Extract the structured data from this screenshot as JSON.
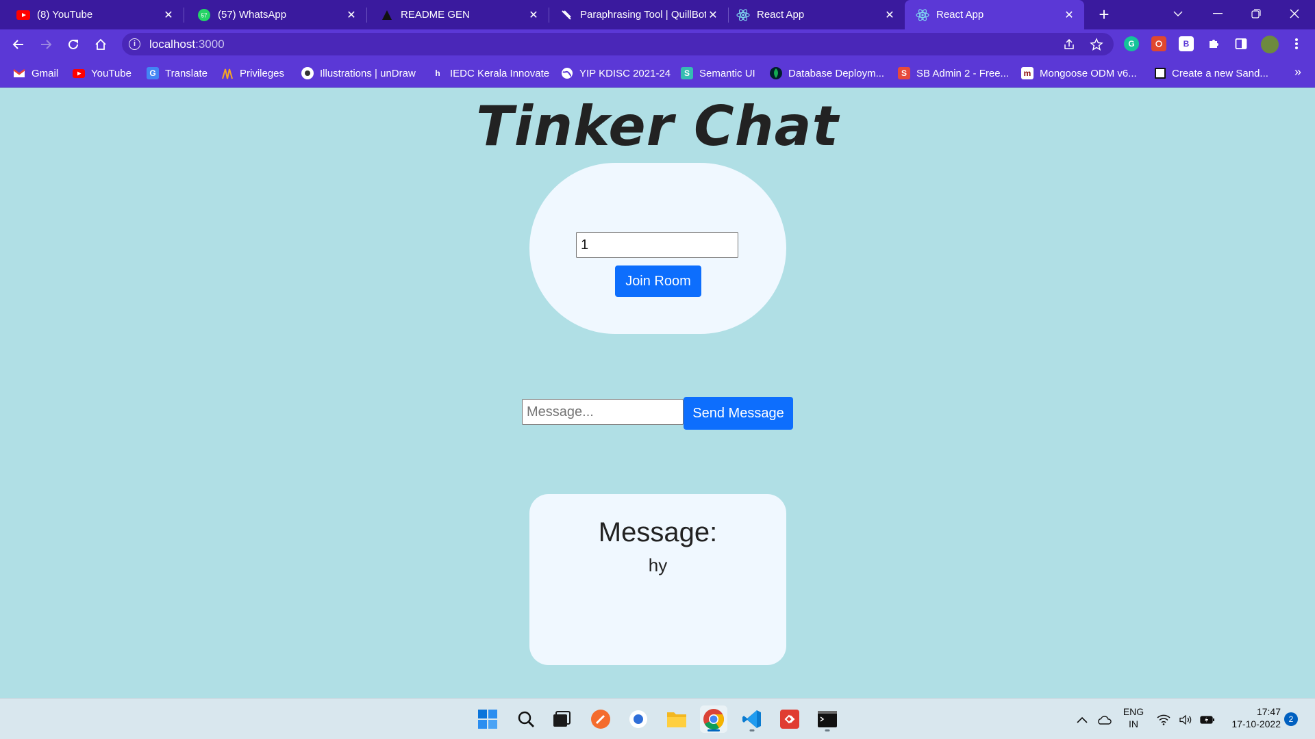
{
  "browser": {
    "tabs": [
      {
        "label": "(8) YouTube",
        "icon": "youtube-icon"
      },
      {
        "label": "(57) WhatsApp",
        "icon": "whatsapp-icon"
      },
      {
        "label": "README GEN",
        "icon": "readme-gen-icon"
      },
      {
        "label": "Paraphrasing Tool | QuillBot",
        "icon": "quillbot-icon"
      },
      {
        "label": "React App",
        "icon": "react-icon"
      },
      {
        "label": "React App",
        "icon": "react-icon",
        "active": true
      }
    ],
    "whatsapp_badge": "57",
    "url_host": "localhost",
    "url_port": ":3000",
    "bookmarks": [
      {
        "label": "Gmail",
        "icon": "gmail-icon"
      },
      {
        "label": "YouTube",
        "icon": "youtube-icon"
      },
      {
        "label": "Translate",
        "icon": "translate-icon"
      },
      {
        "label": "Privileges",
        "icon": "privileges-icon"
      },
      {
        "label": "Illustrations | unDraw",
        "icon": "undraw-icon"
      },
      {
        "label": "IEDC Kerala Innovate",
        "icon": "iedc-icon"
      },
      {
        "label": "YIP KDISC 2021-24",
        "icon": "globe-icon"
      },
      {
        "label": "Semantic UI",
        "icon": "semantic-ui-icon"
      },
      {
        "label": "Database Deploym...",
        "icon": "mongodb-leaf-icon"
      },
      {
        "label": "SB Admin 2 - Free...",
        "icon": "sb-admin-icon"
      },
      {
        "label": "Mongoose ODM v6...",
        "icon": "mongoose-icon"
      },
      {
        "label": "Create a new Sand...",
        "icon": "codesandbox-icon"
      }
    ],
    "colors": {
      "tabbar": "#3a1a9e",
      "toolbar": "#5b38d6"
    }
  },
  "app": {
    "title": "Tinker Chat",
    "room_input_value": "1",
    "join_button": "Join Room",
    "message_placeholder": "Message...",
    "send_button": "Send Message",
    "message_heading": "Message:",
    "message_received": "hy",
    "colors": {
      "background": "#b0dfe5",
      "card": "#f0f8ff",
      "button": "#0d6efd"
    }
  },
  "taskbar": {
    "language_line1": "ENG",
    "language_line2": "IN",
    "time": "17:47",
    "date": "17-10-2022",
    "notification_count": "2"
  }
}
